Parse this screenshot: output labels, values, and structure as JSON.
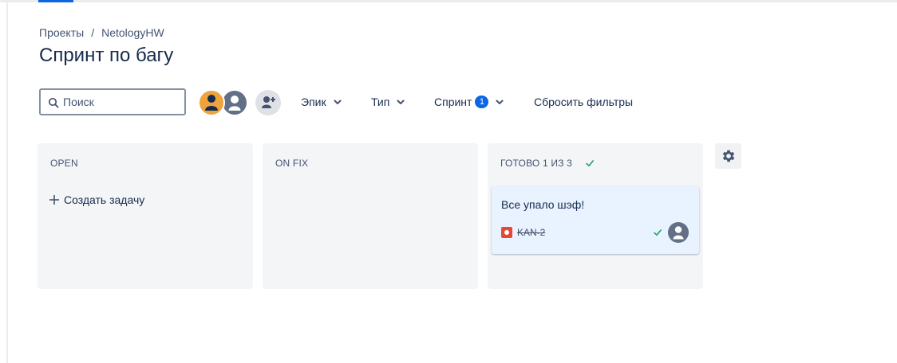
{
  "breadcrumb": {
    "projects": "Проекты",
    "separator": "/",
    "project": "NetologyHW"
  },
  "page_title": "Спринт по багу",
  "search": {
    "placeholder": "Поиск",
    "value": ""
  },
  "filters": {
    "epic": "Эпик",
    "type": "Тип",
    "sprint": "Спринт",
    "sprint_count": "1",
    "reset": "Сбросить фильтры"
  },
  "columns": [
    {
      "title": "OPEN",
      "create_label": "Создать задачу"
    },
    {
      "title": "ON FIX"
    },
    {
      "title": "ГОТОВО 1 ИЗ 3",
      "cards": [
        {
          "title": "Все упало шэф!",
          "key": "KAN-2"
        }
      ]
    }
  ],
  "colors": {
    "accent": "#0c66e4",
    "column_bg": "#f4f5f7",
    "card_bg": "#e9f2ff",
    "done": "#22a06b",
    "bug": "#e34935",
    "avatar_orange": "#f0a23d"
  },
  "icons": [
    "search-icon",
    "avatar-icon",
    "add-person-icon",
    "chevron-down-icon",
    "plus-icon",
    "check-icon",
    "bug-icon",
    "gear-icon"
  ]
}
